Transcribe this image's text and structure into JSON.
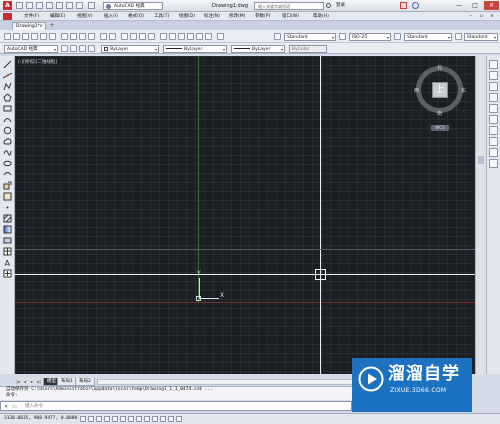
{
  "titlebar": {
    "workspace": "AutoCAD 经典",
    "document_title": "Drawing1.dwg",
    "search_placeholder": "键入关键字或短语",
    "login": "登录",
    "minimize": "—",
    "maximize": "□",
    "close": "✕"
  },
  "menubar": {
    "items": [
      "文件(F)",
      "编辑(E)",
      "视图(V)",
      "插入(I)",
      "格式(O)",
      "工具(T)",
      "绘图(D)",
      "标注(N)",
      "修改(M)",
      "参数(P)",
      "窗口(W)",
      "帮助(H)"
    ]
  },
  "tabs": {
    "file_tab": "Drawing1*",
    "close": "×",
    "add": "+"
  },
  "toolbar1": {
    "text_style": "Standard",
    "dim_style": "ISO-25",
    "table_style": "Standard",
    "multileader_style": "Standard"
  },
  "toolbar2": {
    "workspace": "AutoCAD 经典",
    "color": "ByLayer",
    "linetype": "ByLayer",
    "lineweight": "ByLayer",
    "plot_style": "ByColor"
  },
  "drawing": {
    "viewport_label": "[-][俯视][二维线框]",
    "ucs_y": "Y",
    "ucs_x": "X"
  },
  "viewcube": {
    "north": "北",
    "south": "南",
    "east": "东",
    "west": "西",
    "face": "上",
    "wcs": "WCS"
  },
  "layout_tabs": {
    "items": [
      "模型",
      "布局1",
      "布局2"
    ],
    "active": "模型"
  },
  "command": {
    "history": "自动保存到 C:\\Users\\Administrator\\appdata\\local\\temp\\Drawing1_1_1_0474.sv$ ...",
    "history_prompt": "命令:",
    "input_placeholder": "键入命令"
  },
  "status": {
    "coords": "3138.0835, 908.9477, 0.0000"
  },
  "watermark": {
    "title": "溜溜自学",
    "url": "ZIXUE.3D66.COM"
  },
  "colors": {
    "canvas_bg": "#1b1f24",
    "watermark_bg": "#1d71c1",
    "y_axis_green": "#3fa83f",
    "x_axis_red": "#a83636"
  }
}
